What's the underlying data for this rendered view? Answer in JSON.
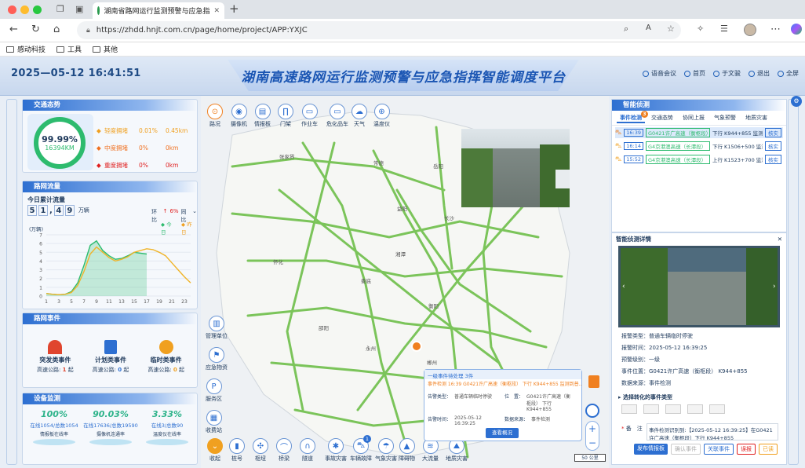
{
  "browser": {
    "tab_title": "湖南省路网运行监测预警与应急指",
    "url": "https://zhdd.hnjt.com.cn/page/home/project/APP:YXJC",
    "bookmarks": [
      "感动科技",
      "工具",
      "其他"
    ]
  },
  "header": {
    "datetime": "2025—05-12  16:41:51",
    "title": "湖南高速路网运行监测预警与应急指挥智能调度平台",
    "nav": [
      "语音会议",
      "首页",
      "于文骏",
      "退出",
      "全屏"
    ]
  },
  "traffic": {
    "section_title": "交通态势",
    "ring_pct": "99.99%",
    "ring_km": "16394KM",
    "rows": [
      {
        "label": "轻度拥堵",
        "pct": "0.01%",
        "km": "0.45km",
        "color": "#f0a020"
      },
      {
        "label": "中度拥堵",
        "pct": "0%",
        "km": "0km",
        "color": "#f07020"
      },
      {
        "label": "重度拥堵",
        "pct": "0%",
        "km": "0km",
        "color": "#e02020"
      }
    ]
  },
  "flow": {
    "section_title": "路网流量",
    "subtitle": "今日累计流量",
    "digits": [
      "5",
      "1",
      "4",
      "9"
    ],
    "unit": "万辆",
    "huanbi": "环比",
    "huanbi_value": "6%",
    "tongbi": "同比",
    "legend": [
      "今日",
      "昨日"
    ],
    "yunit": "(万辆)"
  },
  "chart_data": {
    "type": "area",
    "x": [
      0,
      1,
      2,
      3,
      4,
      5,
      6,
      7,
      8,
      9,
      10,
      11,
      12,
      13,
      14,
      15,
      16,
      17,
      18,
      19,
      20,
      21,
      22,
      23
    ],
    "xticks": [
      "1",
      "3",
      "5",
      "7",
      "9",
      "11",
      "13",
      "15",
      "17",
      "19",
      "21",
      "23"
    ],
    "yticks": [
      "0",
      "1",
      "2",
      "3",
      "4",
      "5",
      "6",
      "7"
    ],
    "ylim": [
      0,
      7
    ],
    "series": [
      {
        "name": "今日",
        "color": "#2dbb6e",
        "values": [
          0.3,
          0.2,
          0.15,
          0.2,
          0.5,
          1.5,
          3.5,
          5.8,
          6.3,
          5.2,
          4.6,
          4.2,
          4.3,
          4.6,
          5.0,
          4.9,
          4.8
        ]
      },
      {
        "name": "昨日",
        "color": "#f0b429",
        "values": [
          0.3,
          0.2,
          0.15,
          0.2,
          0.4,
          1.2,
          2.8,
          4.8,
          5.6,
          5.0,
          4.4,
          4.0,
          4.2,
          4.5,
          5.0,
          5.2,
          5.4,
          5.3,
          5.0,
          4.6,
          3.8,
          3.0,
          2.2,
          1.5
        ]
      }
    ]
  },
  "events": {
    "section_title": "路网事件",
    "cards": [
      {
        "label": "突发类事件",
        "sub": "高速公路:",
        "count": "1",
        "unit": "起",
        "color": "#e0452e"
      },
      {
        "label": "计划类事件",
        "sub": "高速公路:",
        "count": "0",
        "unit": "起",
        "color": "#2d6fd1"
      },
      {
        "label": "临时类事件",
        "sub": "高速公路:",
        "count": "0",
        "unit": "起",
        "color": "#f0a020"
      }
    ]
  },
  "devices": {
    "section_title": "设备监测",
    "items": [
      {
        "pct": "100%",
        "detail": "在线1054/总数1054",
        "label": "情报板在线率"
      },
      {
        "pct": "90.03%",
        "detail": "在线17636/总数19590",
        "label": "摄像机连通率"
      },
      {
        "pct": "3.33%",
        "detail": "在线3/总数90",
        "label": "温度仪在线率"
      }
    ]
  },
  "map": {
    "top_tools": [
      "路况",
      "摄像机",
      "情报板",
      "门架",
      "作业车",
      "危化品车",
      "天气",
      "温度仪"
    ],
    "left_tools": [
      "管理单位",
      "应急物资",
      "服务区",
      "收费站"
    ],
    "bottom_tools": [
      "收起",
      "桩号",
      "枢纽",
      "桥梁",
      "隧道",
      "事故灾害",
      "车辆故障",
      "气象灾害",
      "障碍物",
      "大流量",
      "地质灾害"
    ],
    "bottom_badge": "1",
    "cities": [
      "张家界",
      "常德",
      "益阳",
      "岳阳",
      "长沙",
      "湘潭",
      "娄底",
      "邵阳",
      "衡阳",
      "怀化",
      "永州",
      "郴州"
    ],
    "scale": "50 公里",
    "popup": {
      "head": "一级事件待处理 3件",
      "line": "事件检测 16:39 G0421许广高速（衡枢段） 下行 K944+855 监测到普…",
      "labels": {
        "type": "告警类型：",
        "pos": "位　置：",
        "time": "告警时间：",
        "source": "数据来源："
      },
      "type": "普通车辆临时停驶",
      "pos": "G0421许广高速（衡枢段） 下行 K944+855",
      "time": "2025-05-12 16:39:25",
      "source": "事件检测",
      "button": "查看概况"
    }
  },
  "smart": {
    "section_title": "智能侦测",
    "tabs": [
      "事件检测",
      "交通态势",
      "协同上报",
      "气象预警",
      "地质灾害"
    ],
    "tab_badge": "3",
    "rows": [
      {
        "time": "16:39",
        "road": "G0421许广高速（衡枢段）",
        "desc": "下行 K944+855 监测到普...",
        "btn": "核实"
      },
      {
        "time": "16:14",
        "road": "G4京港澳高速（长潭段）",
        "desc": "下行 K1506+500 监测到...",
        "btn": "核实"
      },
      {
        "time": "15:52",
        "road": "G4京港澳高速（长潭段）",
        "desc": "上行 K1523+700 监测到...",
        "btn": "核实"
      }
    ]
  },
  "detail": {
    "title": "智能侦测详情",
    "fields": [
      {
        "k": "报警类型：",
        "v": "普通车辆临时停驶"
      },
      {
        "k": "报警时间：",
        "v": "2025-05-12 16:39:25"
      },
      {
        "k": "预警级别：",
        "v": "一级"
      },
      {
        "k": "事件位置：",
        "v": "G0421许广高速（衡枢段） K944+855"
      },
      {
        "k": "数据来源：",
        "v": "事件检测"
      }
    ],
    "convert": "选择转化的事件类型",
    "note_label": "备　注",
    "note": "事件检测识别到:【2025-05-12 16:39:25】在G0421许广高速（衡枢段）下行 K944+855",
    "buttons": [
      "发布情报板",
      "确认事件",
      "关联事件",
      "误报",
      "已读"
    ]
  }
}
